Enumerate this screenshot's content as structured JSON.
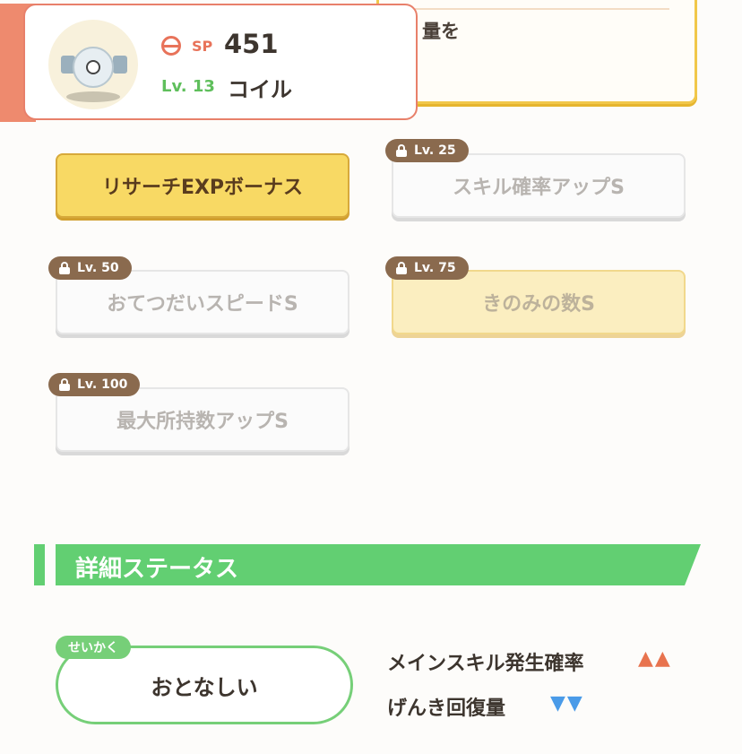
{
  "pokemon": {
    "sp_label": "SP",
    "sp_value": "451",
    "level_label": "Lv. 13",
    "name": "コイル"
  },
  "background_card": {
    "text_fragment": "量を"
  },
  "skills": [
    {
      "label": "リサーチEXPボーナス",
      "state": "active",
      "lock_level": ""
    },
    {
      "label": "スキル確率アップS",
      "state": "locked",
      "lock_level": "Lv. 25"
    },
    {
      "label": "おてつだいスピードS",
      "state": "locked",
      "lock_level": "Lv. 50"
    },
    {
      "label": "きのみの数S",
      "state": "locked",
      "lock_level": "Lv. 75"
    },
    {
      "label": "最大所持数アップS",
      "state": "locked",
      "lock_level": "Lv. 100"
    }
  ],
  "details_section": {
    "title": "詳細ステータス"
  },
  "nature": {
    "tag_label": "せいかく",
    "value": "おとなしい",
    "effects": [
      {
        "label": "メインスキル発生確率",
        "arrows": "▲▲",
        "direction": "up"
      },
      {
        "label": "げんき回復量",
        "arrows": "▼▼",
        "direction": "down"
      }
    ]
  },
  "colors": {
    "accent_orange": "#e8806a",
    "green": "#62cf72",
    "gold": "#f8d964",
    "lock_brown": "#8a6a4e",
    "up_arrow": "#e8734e",
    "down_arrow": "#4a9be8"
  }
}
